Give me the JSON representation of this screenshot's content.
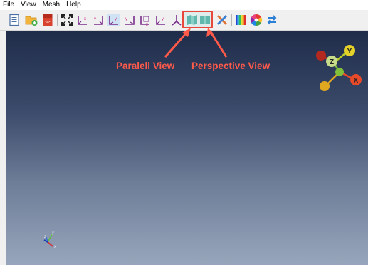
{
  "menu": {
    "items": [
      {
        "label": "File"
      },
      {
        "label": "View"
      },
      {
        "label": "Mesh"
      },
      {
        "label": "Help"
      }
    ]
  },
  "toolbar": {
    "buttons": [
      {
        "icon": "document-icon"
      },
      {
        "icon": "open-folder-icon"
      },
      {
        "icon": "html-export-icon"
      },
      {
        "icon": "fit-view-icon"
      },
      {
        "icon": "view-x-icon"
      },
      {
        "icon": "view-neg-x-icon"
      },
      {
        "icon": "view-y-icon"
      },
      {
        "icon": "view-neg-y-icon"
      },
      {
        "icon": "view-z-icon"
      },
      {
        "icon": "view-neg-z-icon"
      },
      {
        "icon": "isometric-axes-icon"
      },
      {
        "icon": "parallel-view-icon"
      },
      {
        "icon": "perspective-view-icon"
      },
      {
        "icon": "wireframe-cross-icon"
      },
      {
        "icon": "color-bar-icon"
      },
      {
        "icon": "color-wheel-icon"
      },
      {
        "icon": "swap-arrows-icon"
      }
    ]
  },
  "annotations": {
    "parallel_label": "Paralell View",
    "perspective_label": "Perspective View",
    "color": "#ff5a4a"
  },
  "viewport": {
    "orientation_widget": {
      "x_label": "X",
      "y_label": "Y",
      "z_label": "Z"
    },
    "mini_axes": {
      "x_label": "x",
      "y_label": "y",
      "z_label": "z"
    },
    "gradient_top": "#1f2c4a",
    "gradient_bottom": "#98a6bc"
  }
}
